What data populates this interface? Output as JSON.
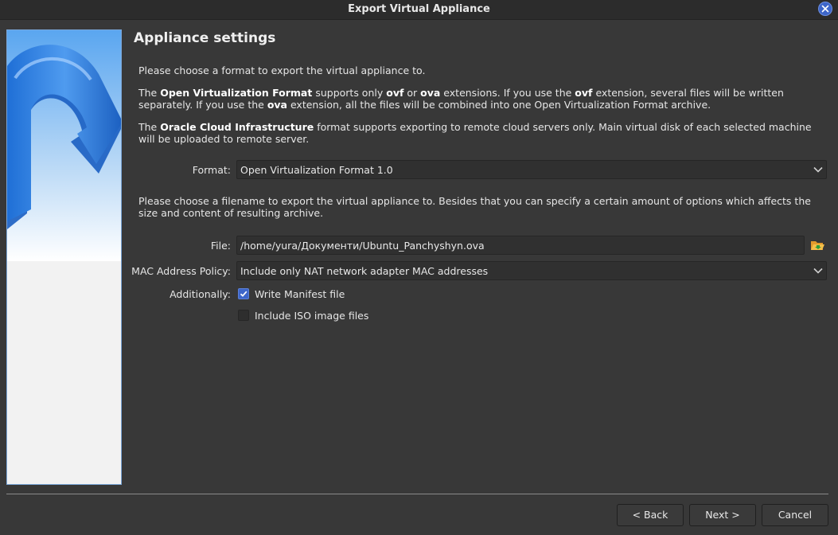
{
  "window": {
    "title": "Export Virtual Appliance"
  },
  "page": {
    "heading": "Appliance settings",
    "intro": "Please choose a format to export the virtual appliance to.",
    "ovf_para": {
      "t1": "The ",
      "b1": "Open Virtualization Format",
      "t2": " supports only ",
      "b2": "ovf",
      "t3": " or ",
      "b3": "ova",
      "t4": " extensions. If you use the ",
      "b4": "ovf",
      "t5": " extension, several files will be written separately. If you use the ",
      "b5": "ova",
      "t6": " extension, all the files will be combined into one Open Virtualization Format archive."
    },
    "oci_para": {
      "t1": "The ",
      "b1": "Oracle Cloud Infrastructure",
      "t2": " format supports exporting to remote cloud servers only. Main virtual disk of each selected machine will be uploaded to remote server."
    },
    "filename_para": "Please choose a filename to export the virtual appliance to. Besides that you can specify a certain amount of options which affects the size and content of resulting archive."
  },
  "form": {
    "format_label": "Format:",
    "format_value": "Open Virtualization Format 1.0",
    "file_label": "File:",
    "file_value": "/home/yura/Документи/Ubuntu_Panchyshyn.ova",
    "mac_label": "MAC Address Policy:",
    "mac_value": "Include only NAT network adapter MAC addresses",
    "additionally_label": "Additionally:",
    "write_manifest_label": "Write Manifest file",
    "write_manifest_checked": true,
    "include_iso_label": "Include ISO image files",
    "include_iso_checked": false
  },
  "buttons": {
    "back": "< Back",
    "next": "Next >",
    "cancel": "Cancel"
  },
  "icons": {
    "close": "close-icon",
    "chevron": "chevron-down-icon",
    "folder": "folder-open-icon"
  },
  "colors": {
    "accent": "#3d66c9",
    "background": "#383838"
  }
}
